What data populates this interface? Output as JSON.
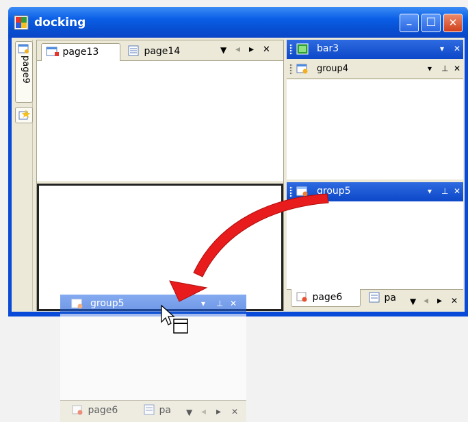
{
  "window": {
    "title": "docking"
  },
  "titlebar_buttons": {
    "minimize": "_",
    "maximize": "□",
    "close": "✕"
  },
  "sidebar": {
    "tabs": [
      {
        "label": "page9"
      }
    ]
  },
  "document": {
    "tabs": [
      {
        "label": "page13",
        "active": true
      },
      {
        "label": "page14",
        "active": false
      }
    ]
  },
  "panes": {
    "bar3": {
      "title": "bar3"
    },
    "group4": {
      "title": "group4"
    },
    "group5": {
      "title": "group5"
    },
    "bottom_tabs": [
      {
        "label": "page6"
      },
      {
        "label": "pa"
      }
    ]
  },
  "floating": {
    "title": "group5",
    "bottom_tabs": [
      {
        "label": "page6"
      },
      {
        "label": "pa"
      }
    ]
  },
  "controls": {
    "menu": "▼",
    "left": "◂",
    "right": "▸",
    "close": "✕",
    "pin": "⊥",
    "dropdown": "▾"
  },
  "colors": {
    "title_blue": "#0a5ee6",
    "panel_beige": "#ece9d8",
    "arrow_red": "#e81c1c"
  }
}
